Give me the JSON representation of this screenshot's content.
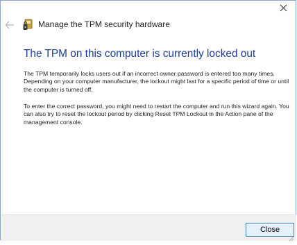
{
  "window": {
    "close_glyph": "✕"
  },
  "wizard": {
    "title": "Manage the TPM security hardware",
    "back_icon": "back-arrow-icon",
    "app_icon": "tpm-chip-icon"
  },
  "content": {
    "heading": "The TPM on this computer is currently locked out",
    "paragraph1": "The TPM temporarily locks users out if an incorrect owner password is entered too many times.  Depending on your computer manufacturer, the lockout might last for a specific period of time or until the computer is turned off.",
    "paragraph2": "To enter the correct password, you might need to restart the computer and run this wizard again. You can also try to reset the lockout period by clicking Reset TPM Lockout in the Action pane of the management console."
  },
  "footer": {
    "close_label": "Close"
  },
  "colors": {
    "heading": "#1b3d94",
    "button_border": "#3c7fb1",
    "button_bg": "#e5f1fb",
    "footer_bg": "#f0f0f0"
  }
}
